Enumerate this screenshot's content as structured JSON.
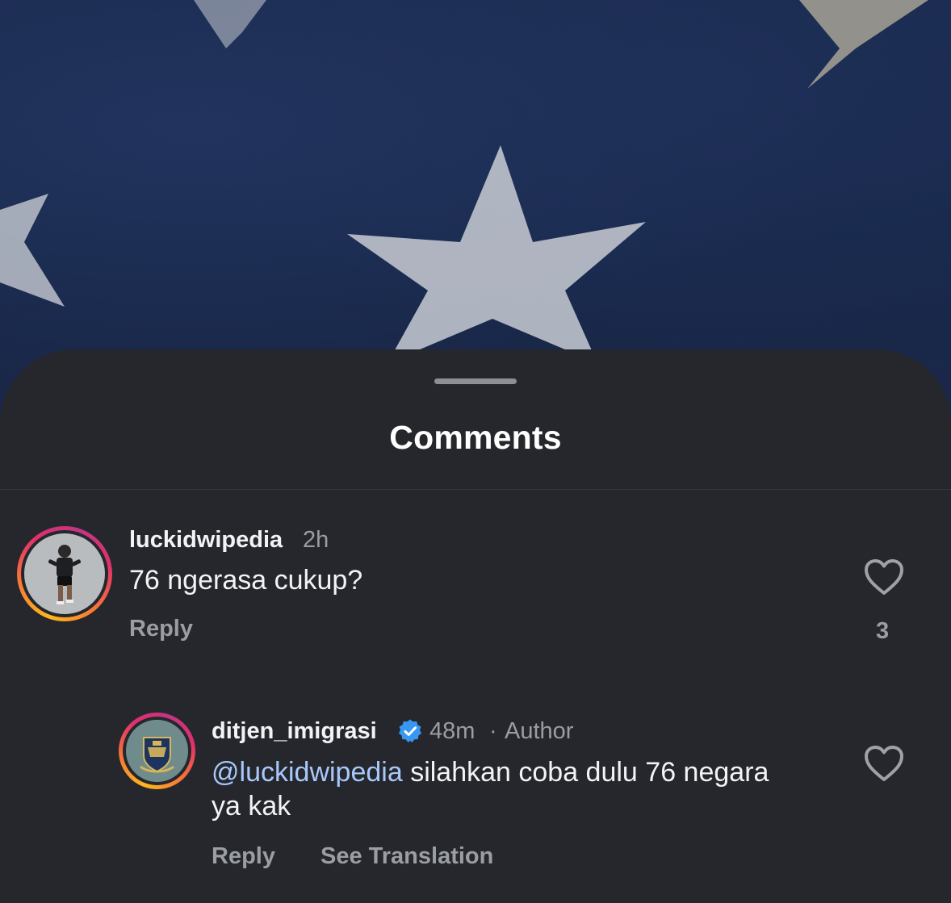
{
  "sheet": {
    "title": "Comments"
  },
  "comments": [
    {
      "username": "luckidwipedia",
      "time": "2h",
      "text": "76 ngerasa cukup?",
      "reply_label": "Reply",
      "like_count": "3"
    },
    {
      "username": "ditjen_imigrasi",
      "verified": true,
      "time": "48m",
      "separator": "·",
      "author_tag": "Author",
      "mention": "@luckidwipedia",
      "text": " silahkan coba dulu 76 negara ya kak",
      "reply_label": "Reply",
      "translate_label": "See Translation"
    }
  ],
  "colors": {
    "sheet_bg": "#25272c",
    "mention": "#a8c8fb",
    "verified_badge": "#3897f0",
    "muted_text": "#9a9da3"
  },
  "icons": [
    "heart-outline-icon",
    "verified-badge-icon",
    "grabber-handle"
  ]
}
